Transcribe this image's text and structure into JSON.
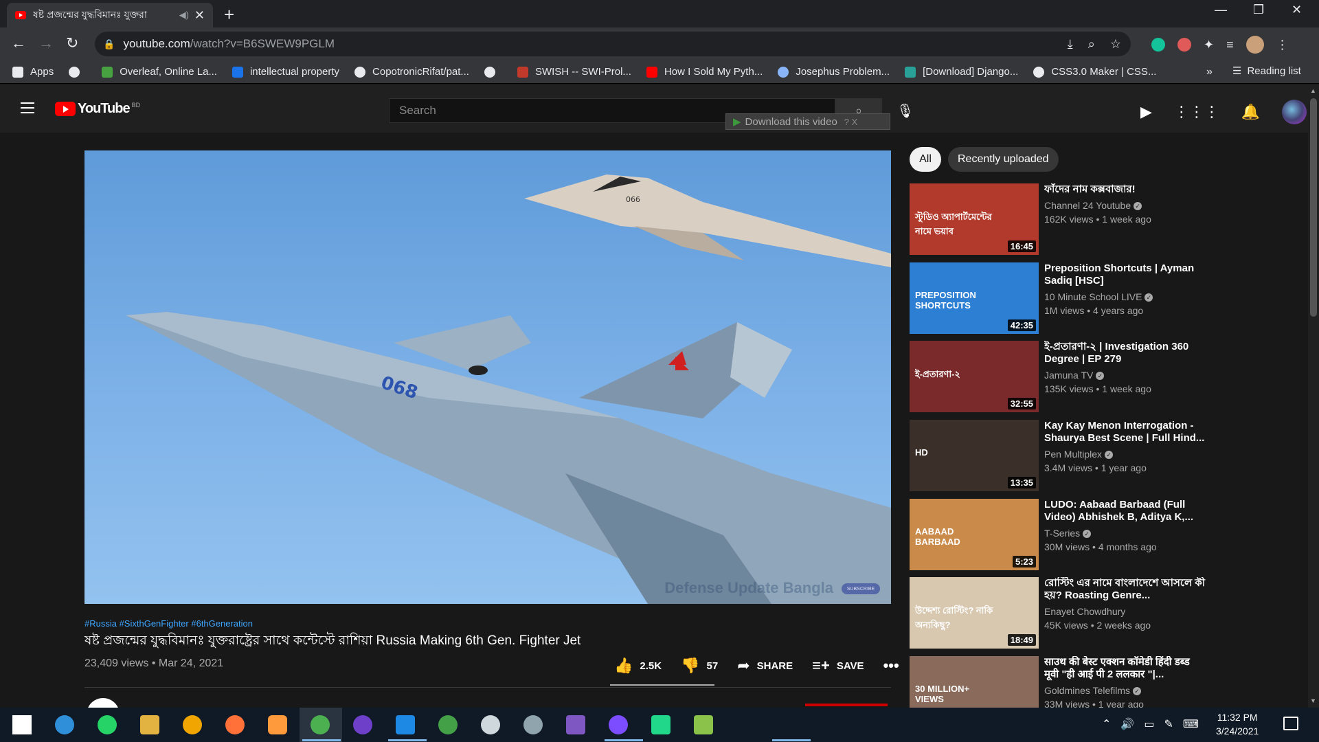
{
  "browser": {
    "tab_title": "ষষ্ট প্রজন্মের যুদ্ধবিমানঃ যুক্তরা",
    "url_host": "youtube.com",
    "url_path": "/watch?v=B6SWEW9PGLM",
    "bookmarks": [
      {
        "label": "Apps",
        "icon": "apps-grid-icon",
        "color": "#e8eaed"
      },
      {
        "label": "",
        "icon": "globe-icon",
        "color": "#e8eaed"
      },
      {
        "label": "Overleaf, Online La...",
        "icon": "overleaf-icon",
        "color": "#47a141"
      },
      {
        "label": "intellectual property",
        "icon": "bookmark-blue-icon",
        "color": "#1a73e8"
      },
      {
        "label": "CopotronicRifat/pat...",
        "icon": "github-icon",
        "color": "#e8eaed"
      },
      {
        "label": "",
        "icon": "globe-icon",
        "color": "#e8eaed"
      },
      {
        "label": "SWISH -- SWI-Prol...",
        "icon": "swish-icon",
        "color": "#c0392b"
      },
      {
        "label": "How I Sold My Pyth...",
        "icon": "youtube-icon",
        "color": "#ff0000"
      },
      {
        "label": "Josephus Problem...",
        "icon": "loading-icon",
        "color": "#8ab4f8"
      },
      {
        "label": "[Download] Django...",
        "icon": "django-icon",
        "color": "#2aa198"
      },
      {
        "label": "CSS3.0 Maker | CSS...",
        "icon": "globe-icon",
        "color": "#e8eaed"
      }
    ],
    "more_label": "»",
    "reading_list": "Reading list"
  },
  "youtube": {
    "logo_text": "YouTube",
    "country": "BD",
    "search_placeholder": "Search",
    "download_overlay": "Download this video",
    "download_overlay_help": "? X"
  },
  "video": {
    "hashtags": "#Russia #SixthGenFighter #6thGeneration",
    "title": "ষষ্ট প্রজন্মের যুদ্ধবিমানঃ যুক্তরাষ্ট্রের সাথে কন্টেস্টে রাশিয়া Russia Making 6th Gen. Fighter Jet",
    "views_date": "23,409 views • Mar 24, 2021",
    "likes": "2.5K",
    "dislikes": "57",
    "share": "SHARE",
    "save": "SAVE",
    "watermark": "Defense Update Bangla",
    "jet_number": "068",
    "jet_number_2": "066"
  },
  "sidebar": {
    "chips": [
      "All",
      "Recently uploaded"
    ],
    "items": [
      {
        "title": "ফাঁদের নাম কক্সবাজার!",
        "channel": "Channel 24 Youtube",
        "verified": true,
        "meta": "162K views • 1 week ago",
        "duration": "16:45",
        "thumb_bg": "#b23a2c",
        "thumb_text": "স্টুডিও অ্যাপার্টমেন্টের নামে ভয়াব"
      },
      {
        "title": "Preposition Shortcuts | Ayman Sadiq [HSC]",
        "channel": "10 Minute School LIVE",
        "verified": true,
        "meta": "1M views • 4 years ago",
        "duration": "42:35",
        "thumb_bg": "#2d7fd3",
        "thumb_text": "PREPOSITION SHORTCUTS"
      },
      {
        "title": "ই-প্রতারণা-২ | Investigation 360 Degree | EP 279",
        "channel": "Jamuna TV",
        "verified": true,
        "meta": "135K views • 1 week ago",
        "duration": "32:55",
        "thumb_bg": "#7a2a2a",
        "thumb_text": "ই-প্রতারণা-২"
      },
      {
        "title": "Kay Kay Menon Interrogation - Shaurya Best Scene | Full Hind...",
        "channel": "Pen Multiplex",
        "verified": true,
        "meta": "3.4M views • 1 year ago",
        "duration": "13:35",
        "thumb_bg": "#3b2f2a",
        "thumb_text": "HD"
      },
      {
        "title": "LUDO: Aabaad Barbaad (Full Video) Abhishek B, Aditya K,...",
        "channel": "T-Series",
        "verified": true,
        "meta": "30M views • 4 months ago",
        "duration": "5:23",
        "thumb_bg": "#c98a4a",
        "thumb_text": "AABAAD BARBAAD"
      },
      {
        "title": "রোস্টিং এর নামে বাংলাদেশে আসলে কী হয়? Roasting Genre...",
        "channel": "Enayet Chowdhury",
        "verified": false,
        "meta": "45K views • 2 weeks ago",
        "duration": "18:49",
        "thumb_bg": "#d8c8b0",
        "thumb_text": "উদ্দেশ্য রোস্টিং? নাকি অন্যকিছু?"
      },
      {
        "title": "साउथ की बेस्ट एक्शन कॉमेडी हिंदी डब्ड मूवी \"ही आई पी 2 ललकार \"|...",
        "channel": "Goldmines Telefilms",
        "verified": true,
        "meta": "33M views • 1 year ago",
        "duration": "",
        "thumb_bg": "#8a6a5a",
        "thumb_text": "30 MILLION+ VIEWS"
      }
    ]
  },
  "taskbar": {
    "time": "11:32 PM",
    "date": "3/24/2021"
  },
  "colors": {
    "yt_red": "#ff0000",
    "link_blue": "#3ea6ff",
    "bg": "#181818"
  }
}
